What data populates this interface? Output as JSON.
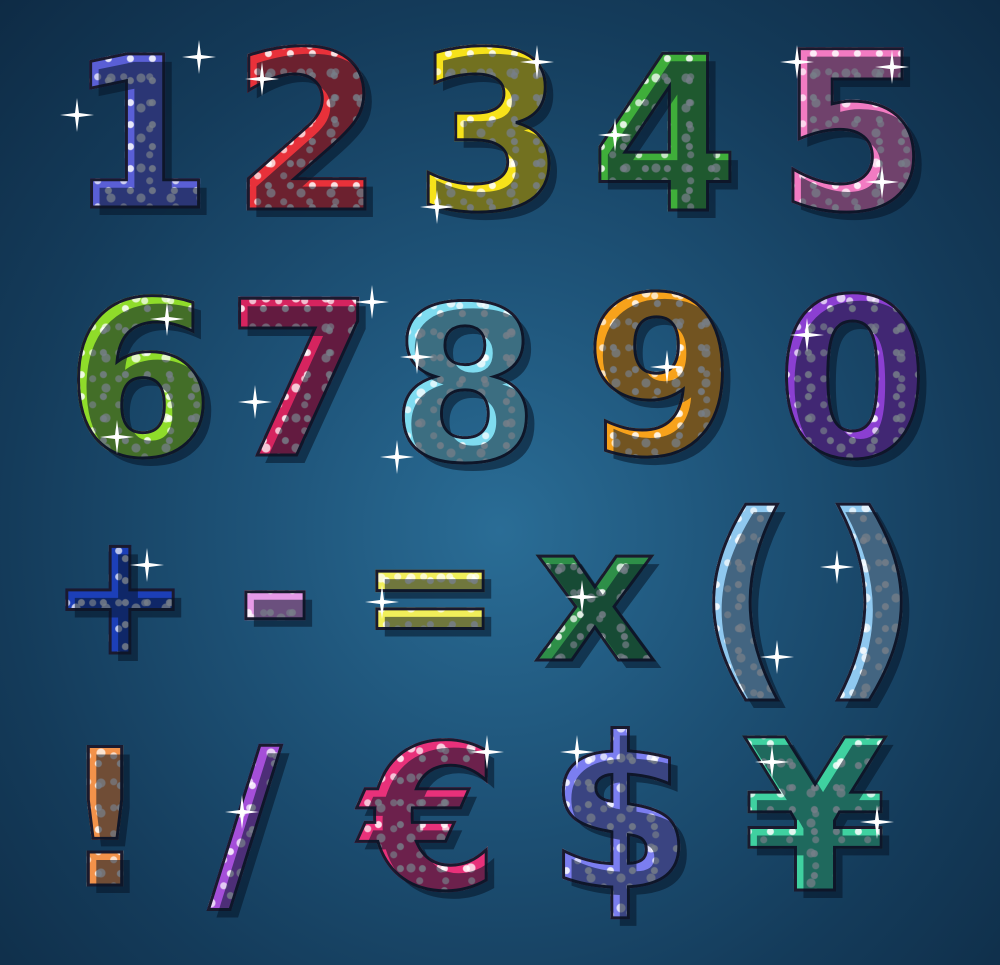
{
  "glyphs": {
    "row1": [
      {
        "char": "1",
        "color": "#5a5fd6"
      },
      {
        "char": "2",
        "color": "#e8313a"
      },
      {
        "char": "3",
        "color": "#f6e21a"
      },
      {
        "char": "4",
        "color": "#3fae3a"
      },
      {
        "char": "5",
        "color": "#f27bc2"
      }
    ],
    "row2": [
      {
        "char": "6",
        "color": "#8fdc2a"
      },
      {
        "char": "7",
        "color": "#d6245f"
      },
      {
        "char": "8",
        "color": "#7fdcf0"
      },
      {
        "char": "9",
        "color": "#f7a21b"
      },
      {
        "char": "0",
        "color": "#8b3fd1"
      }
    ],
    "row3": [
      {
        "char": "+",
        "color": "#1c3fb8"
      },
      {
        "char": "-",
        "color": "#e79ae8"
      },
      {
        "char": "=",
        "color": "#f1ef5a"
      },
      {
        "char": "x",
        "color": "#2e8f48"
      },
      {
        "char": "(",
        "color": "#8fc8ef"
      },
      {
        "char": ")",
        "color": "#8fc8ef"
      }
    ],
    "row4": [
      {
        "char": "!",
        "color": "#f2924a"
      },
      {
        "char": "/",
        "color": "#a54fd9"
      },
      {
        "char": "€",
        "color": "#e8317a"
      },
      {
        "char": "$",
        "color": "#7b7ef0"
      },
      {
        "char": "¥",
        "color": "#3fd1a0"
      }
    ]
  },
  "background_color": "#1e5378",
  "outline_color": "#1a1a2e"
}
